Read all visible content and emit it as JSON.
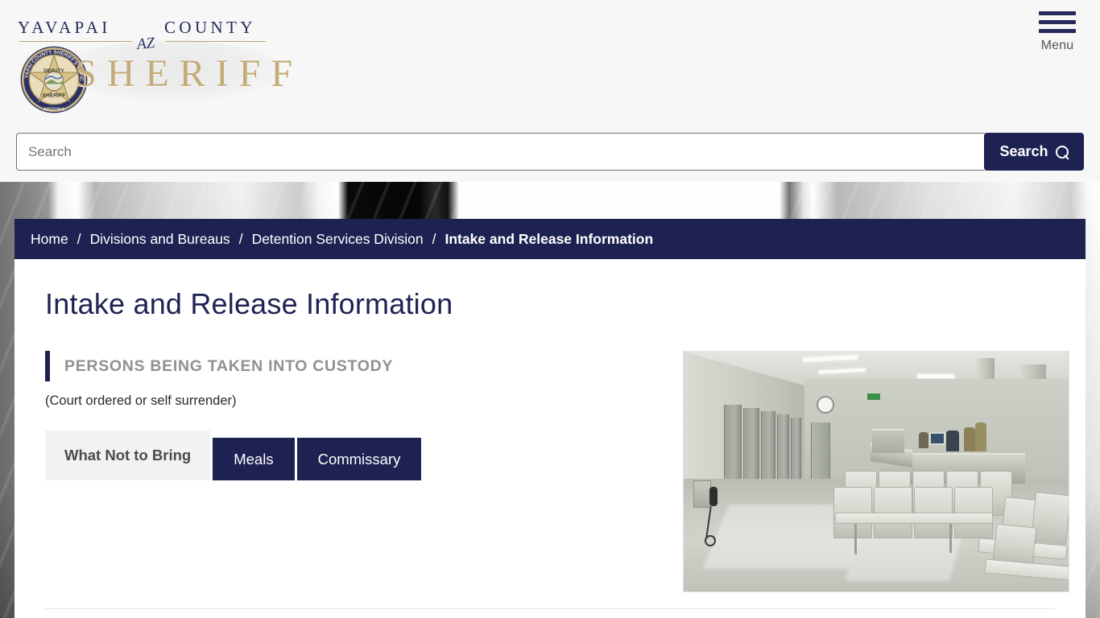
{
  "header": {
    "logo": {
      "line1_word1": "YAVAPAI",
      "line1_state": "AZ",
      "line1_word2": "COUNTY",
      "line2": "SHERIFF",
      "badge_alt": "sheriff-badge"
    },
    "menu": {
      "label": "Menu",
      "icon": "hamburger-icon"
    }
  },
  "search": {
    "placeholder": "Search",
    "value": "",
    "button_label": "Search",
    "button_icon": "magnifier-icon"
  },
  "breadcrumb": {
    "separator": "/",
    "items": [
      {
        "label": "Home",
        "current": false
      },
      {
        "label": "Divisions and Bureaus",
        "current": false
      },
      {
        "label": "Detention Services Division",
        "current": false
      },
      {
        "label": "Intake and Release Information",
        "current": true
      }
    ]
  },
  "main": {
    "page_title": "Intake and Release Information",
    "section_title": "PERSONS BEING TAKEN INTO CUSTODY",
    "section_subtitle": "(Court ordered or self surrender)",
    "tabs": [
      {
        "label": "What Not to Bring",
        "active": true
      },
      {
        "label": "Meals",
        "active": false
      },
      {
        "label": "Commissary",
        "active": false
      }
    ],
    "panel_text": "",
    "photo_alt": "jail-intake-lobby-photo"
  },
  "hero": {
    "alt": "jail-corridor-banner-photo"
  },
  "colors": {
    "navy": "#1d2252",
    "gold": "#c3ac79",
    "header_bg": "#f7f7f7",
    "tab_active_bg": "#f2f2f2",
    "section_title_gray": "#8f9094"
  }
}
